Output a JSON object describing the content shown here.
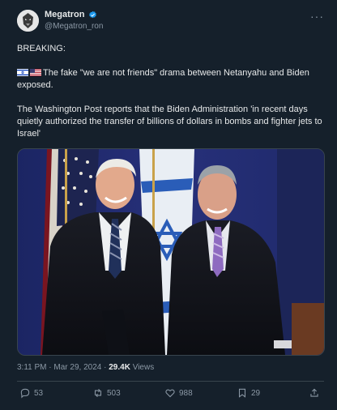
{
  "author": {
    "name": "Megatron",
    "handle": "@Megatron_ron",
    "verified": true
  },
  "more_icon": "ellipsis-icon",
  "tweet": {
    "line1": "BREAKING:",
    "line2": "The fake \"we are not friends\" drama between Netanyahu and Biden exposed.",
    "line3": "The Washington Post reports that the Biden Administration 'in recent days quietly authorized the transfer of billions of dollars in bombs and fighter jets to Israel'",
    "flags": [
      "israel-flag-icon",
      "us-flag-icon"
    ]
  },
  "meta": {
    "time": "3:11 PM",
    "sep1": "·",
    "date": "Mar 29, 2024",
    "sep2": "·",
    "views_count": "29.4K",
    "views_label": "Views"
  },
  "actions": {
    "replies": "53",
    "reposts": "503",
    "likes": "988",
    "bookmarks": "29"
  },
  "colors": {
    "background": "#15202b",
    "text": "#e7e9ea",
    "muted": "#8b98a5",
    "verified": "#1d9bf0",
    "divider": "#38444d"
  }
}
